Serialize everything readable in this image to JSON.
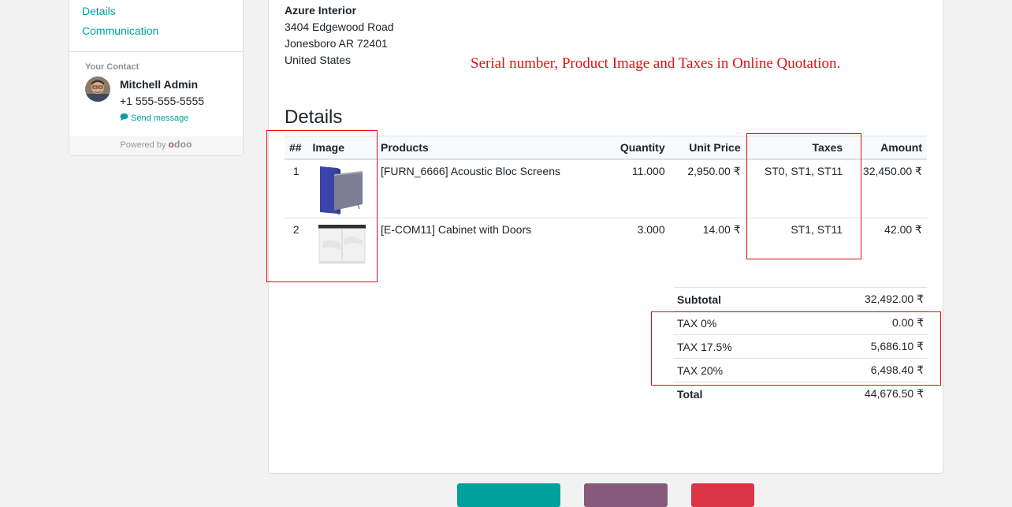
{
  "sidebar": {
    "links": [
      {
        "label": "Details"
      },
      {
        "label": "Communication"
      }
    ],
    "contact_title": "Your Contact",
    "contact_name": "Mitchell Admin",
    "contact_phone": "+1 555-555-5555",
    "send_message": "Send message",
    "powered_by": "Powered by",
    "powered_logo": "odoo"
  },
  "customer": {
    "name": "Azure Interior",
    "street": "3404 Edgewood Road",
    "city": "Jonesboro AR 72401",
    "country": "United States"
  },
  "annotation": "Serial number, Product Image and Taxes in Online Quotation.",
  "details_title": "Details",
  "table": {
    "headers": {
      "serial": "##",
      "image": "Image",
      "products": "Products",
      "quantity": "Quantity",
      "unit_price": "Unit Price",
      "taxes": "Taxes",
      "amount": "Amount"
    },
    "rows": [
      {
        "serial": "1",
        "product": "[FURN_6666] Acoustic Bloc Screens",
        "quantity": "11.000",
        "unit_price": "2,950.00 ₹",
        "taxes": "ST0, ST1, ST11",
        "amount": "32,450.00 ₹"
      },
      {
        "serial": "2",
        "product": "[E-COM11] Cabinet with Doors",
        "quantity": "3.000",
        "unit_price": "14.00 ₹",
        "taxes": "ST1, ST11",
        "amount": "42.00 ₹"
      }
    ]
  },
  "totals": {
    "subtotal_label": "Subtotal",
    "subtotal": "32,492.00 ₹",
    "taxes": [
      {
        "label": "TAX 0%",
        "amount": "0.00 ₹"
      },
      {
        "label": "TAX 17.5%",
        "amount": "5,686.10 ₹"
      },
      {
        "label": "TAX 20%",
        "amount": "6,498.40 ₹"
      }
    ],
    "total_label": "Total",
    "total": "44,676.50 ₹"
  },
  "colors": {
    "accent": "#00a09d",
    "annotation_red": "#e01010",
    "accept_button": "#00a09d",
    "feedback_button": "#875a7b",
    "reject_button": "#dc3545"
  }
}
